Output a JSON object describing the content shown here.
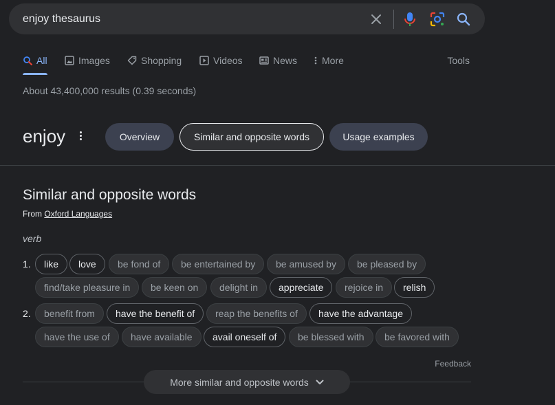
{
  "search": {
    "query": "enjoy thesaurus",
    "icons": [
      "clear-icon",
      "microphone-icon",
      "lens-icon",
      "search-icon"
    ]
  },
  "tabs": [
    {
      "label": "All",
      "icon": "search-icon"
    },
    {
      "label": "Images",
      "icon": "image-icon"
    },
    {
      "label": "Shopping",
      "icon": "tag-icon"
    },
    {
      "label": "Videos",
      "icon": "play-icon"
    },
    {
      "label": "News",
      "icon": "news-icon"
    },
    {
      "label": "More",
      "icon": "kebab-icon"
    }
  ],
  "tools_label": "Tools",
  "stats": "About 43,400,000 results (0.39 seconds)",
  "word": "enjoy",
  "nav_chips": [
    "Overview",
    "Similar and opposite words",
    "Usage examples"
  ],
  "section": {
    "title": "Similar and opposite words",
    "from_prefix": "From",
    "source": "Oxford Languages",
    "pos": "verb"
  },
  "senses": [
    {
      "number": "1.",
      "rows": [
        [
          {
            "text": "like",
            "strong": true
          },
          {
            "text": "love",
            "strong": true
          },
          {
            "text": "be fond of",
            "strong": false
          },
          {
            "text": "be entertained by",
            "strong": false
          },
          {
            "text": "be amused by",
            "strong": false
          },
          {
            "text": "be pleased by",
            "strong": false
          }
        ],
        [
          {
            "text": "find/take pleasure in",
            "strong": false
          },
          {
            "text": "be keen on",
            "strong": false
          },
          {
            "text": "delight in",
            "strong": false
          },
          {
            "text": "appreciate",
            "strong": true
          },
          {
            "text": "rejoice in",
            "strong": false
          },
          {
            "text": "relish",
            "strong": true
          }
        ]
      ]
    },
    {
      "number": "2.",
      "rows": [
        [
          {
            "text": "benefit from",
            "strong": false
          },
          {
            "text": "have the benefit of",
            "strong": true
          },
          {
            "text": "reap the benefits of",
            "strong": false
          },
          {
            "text": "have the advantage",
            "strong": true
          }
        ],
        [
          {
            "text": "have the use of",
            "strong": false
          },
          {
            "text": "have available",
            "strong": false
          },
          {
            "text": "avail oneself of",
            "strong": true
          },
          {
            "text": "be blessed with",
            "strong": false
          },
          {
            "text": "be favored with",
            "strong": false
          }
        ]
      ]
    }
  ],
  "feedback": "Feedback",
  "more_button": "More similar and opposite words",
  "colors": {
    "background": "#202124",
    "accent": "#8ab4f8",
    "mic_blue": "#4285f4",
    "mic_red": "#ea4335"
  }
}
